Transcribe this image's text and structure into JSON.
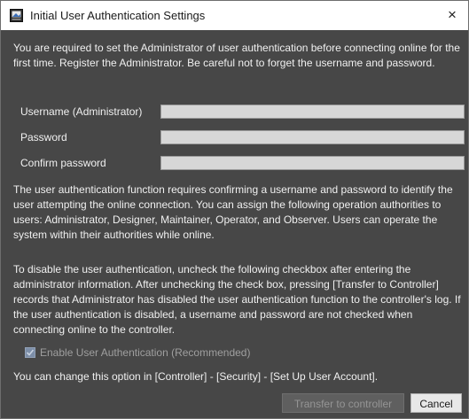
{
  "window": {
    "title": "Initial User Authentication Settings",
    "close_symbol": "×",
    "icon": "app-icon"
  },
  "intro": "You are required to set the Administrator of user authentication before connecting online for the first time. Register the Administrator. Be careful not to forget the username and password.",
  "fields": {
    "username_label": "Username (Administrator)",
    "username_value": "",
    "password_label": "Password",
    "password_value": "",
    "confirm_label": "Confirm password",
    "confirm_value": ""
  },
  "description": "The user authentication function requires confirming a username and password to identify the user attempting the online connection. You can assign the following operation authorities to users: Administrator, Designer, Maintainer, Operator, and Observer. Users can operate the system within their authorities while online.",
  "disable_info": "To disable the user authentication, uncheck the following checkbox after entering the administrator information. After unchecking the check box, pressing [Transfer to Controller] records that Administrator has disabled the user authentication function to the controller's log. If the user authentication is disabled, a username and password are not checked when connecting online to the controller.",
  "checkbox": {
    "label": "Enable User Authentication (Recommended)",
    "checked": true,
    "enabled": false
  },
  "change_info": "You can change this option in [Controller] - [Security] - [Set Up User Account].",
  "buttons": {
    "transfer_label": "Transfer to controller",
    "cancel_label": "Cancel"
  },
  "colors": {
    "background": "#474747",
    "text": "#f0f0f0",
    "field": "#d7d7d7",
    "disabled_text": "#9f9f9f"
  }
}
